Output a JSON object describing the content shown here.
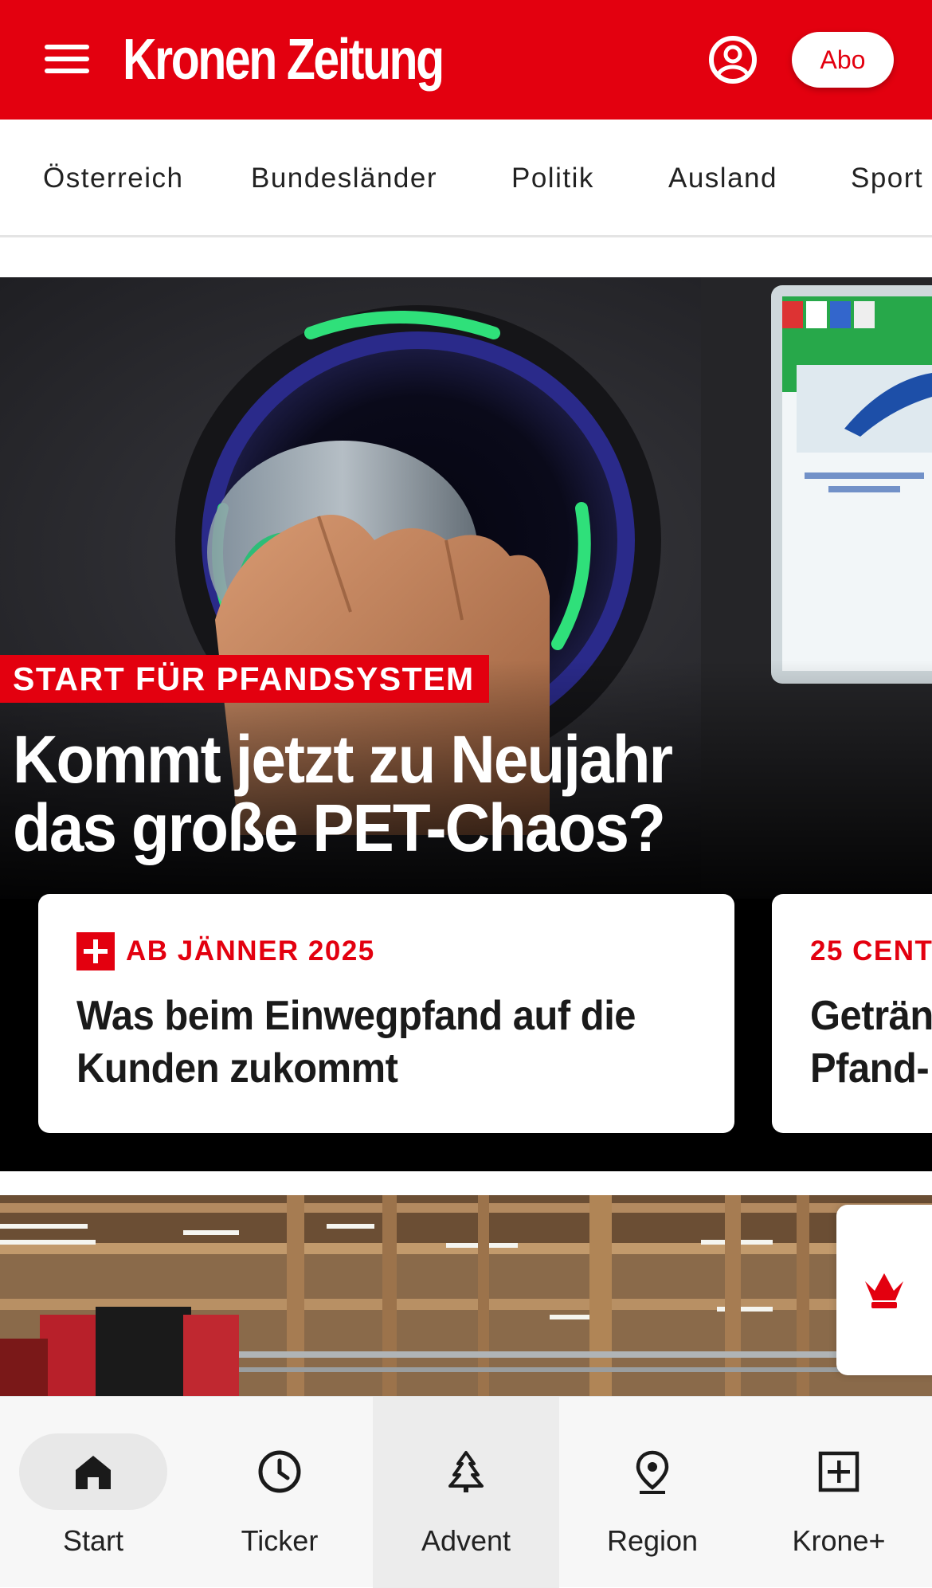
{
  "header": {
    "logo_text": "Kronen Zeitung",
    "abo_label": "Abo",
    "brand_color": "#e3000f",
    "menu_icon": "hamburger-menu-icon",
    "account_icon": "user-circle-icon"
  },
  "nav": {
    "items": [
      {
        "label": "Österreich"
      },
      {
        "label": "Bundesländer"
      },
      {
        "label": "Politik"
      },
      {
        "label": "Ausland"
      },
      {
        "label": "Sport"
      }
    ]
  },
  "hero": {
    "kicker": "START FÜR PFANDSYSTEM",
    "title_line1": "Kommt jetzt zu Neujahr",
    "title_line2": "das große PET-Chaos?",
    "image_desc": "hand-inserting-bottle-into-return-machine",
    "cards": [
      {
        "kicker": "AB JÄNNER 2025",
        "plus": true,
        "title_line1": "Was beim Einwegpfand auf die",
        "title_line2": "Kunden zukommt"
      },
      {
        "kicker": "25 CENT",
        "plus": false,
        "title_line1": "Geträn",
        "title_line2": "Pfand-"
      }
    ]
  },
  "bottom_nav": {
    "tabs": [
      {
        "label": "Start",
        "icon": "home-icon"
      },
      {
        "label": "Ticker",
        "icon": "clock-icon"
      },
      {
        "label": "Advent",
        "icon": "tree-icon"
      },
      {
        "label": "Region",
        "icon": "location-pin-icon"
      },
      {
        "label": "Krone+",
        "icon": "plus-square-icon"
      }
    ]
  }
}
